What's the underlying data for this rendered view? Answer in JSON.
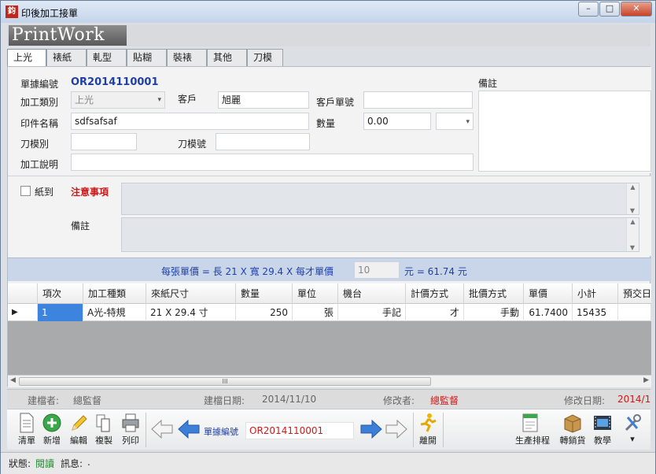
{
  "window": {
    "title": "印後加工接單",
    "icon_text": "鈞",
    "min": "–",
    "max": "□",
    "close": "✕"
  },
  "logo": "PrintWork",
  "tabs": [
    "上光",
    "裱紙",
    "軋型",
    "貼糊",
    "裝裱",
    "其他",
    "刀模"
  ],
  "form": {
    "bill_no_label": "單據編號",
    "bill_no": "OR2014110001",
    "process_type_label": "加工類別",
    "process_type": "上光",
    "customer_label": "客戶",
    "customer": "旭麗",
    "customer_bill_label": "客戶單號",
    "customer_bill": "",
    "product_label": "印件名稱",
    "product": "sdfsafsaf",
    "quantity_label": "數量",
    "quantity": "0.00",
    "unit": "",
    "die_type_label": "刀模別",
    "die_type": "",
    "die_no_label": "刀模號",
    "die_no": "",
    "process_desc_label": "加工說明",
    "process_desc": "",
    "notes_label": "備註",
    "notes": ""
  },
  "attention": {
    "paper_arrived_label": "紙到",
    "attention_label": "注意事項",
    "remark_label": "備註"
  },
  "price_bar": {
    "formula": "每張單價 = 長 21 X 寬 29.4 X 每才單價",
    "unit_price_value": "10",
    "result": "元 = 61.74 元"
  },
  "grid": {
    "columns": [
      "項次",
      "加工種類",
      "來紙尺寸",
      "數量",
      "單位",
      "機台",
      "計價方式",
      "批價方式",
      "單價",
      "小計",
      "預交日"
    ],
    "rows": [
      {
        "item": "1",
        "process": "A光-特規",
        "size": "21 X 29.4 寸",
        "qty": "250",
        "unit": "張",
        "machine": "手記",
        "pricing": "才",
        "batch": "手動",
        "price": "61.7400",
        "subtotal": "15435",
        "due": ""
      }
    ],
    "hscroll_grip": "III"
  },
  "audit": {
    "creator_label": "建檔者:",
    "creator": "總監督",
    "created_label": "建檔日期:",
    "created": "2014/11/10",
    "modifier_label": "修改者:",
    "modifier": "總監督",
    "modified_label": "修改日期:",
    "modified": "2014/1"
  },
  "toolbar": {
    "clear": "清單",
    "add": "新增",
    "edit": "編輯",
    "copy": "複製",
    "print": "列印",
    "bill_no_label": "單據編號",
    "bill_no_value": "OR2014110001",
    "leave": "離開",
    "schedule": "生產排程",
    "shipping": "轉銷貨",
    "teach": "教學"
  },
  "status": {
    "state_label": "狀態:",
    "state": "閱讀",
    "msg_label": "訊息:",
    "msg": "."
  },
  "colors": {
    "accent_blue": "#1f3fa6",
    "attention_red": "#cc1a1a",
    "modified_red": "#cc1a1a",
    "status_green": "#1e8a2e"
  }
}
